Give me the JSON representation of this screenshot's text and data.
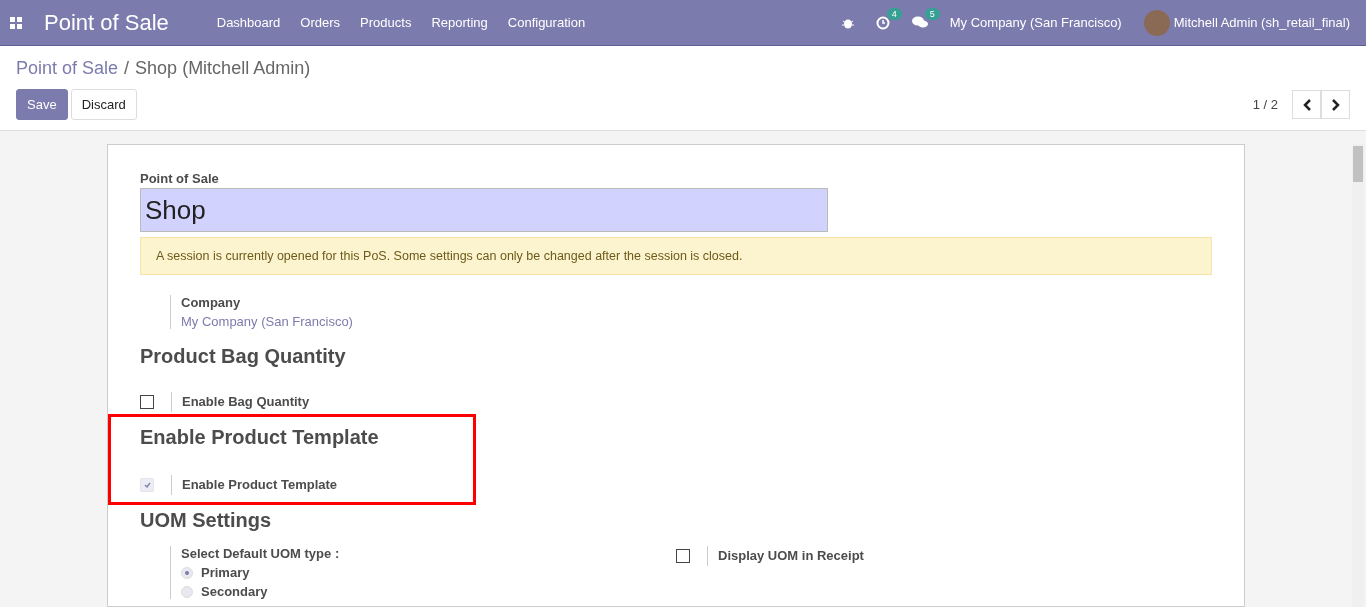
{
  "navbar": {
    "app_title": "Point of Sale",
    "menu": [
      "Dashboard",
      "Orders",
      "Products",
      "Reporting",
      "Configuration"
    ],
    "activity_count": "4",
    "message_count": "5",
    "company": "My Company (San Francisco)",
    "user": "Mitchell Admin (sh_retail_final)"
  },
  "breadcrumb": {
    "parent": "Point of Sale",
    "separator": "/",
    "current": "Shop (Mitchell Admin)"
  },
  "buttons": [
    {
      "label": "Save",
      "kind": "primary"
    },
    {
      "label": "Discard",
      "kind": "secondary"
    }
  ],
  "pager": {
    "value": "1 / 2"
  },
  "form": {
    "name_label": "Point of Sale",
    "name_value": "Shop",
    "alert": "A session is currently opened for this PoS. Some settings can only be changed after the session is closed.",
    "company_label": "Company",
    "company_value": "My Company (San Francisco)",
    "sections": [
      {
        "title": "Product Bag Quantity",
        "highlighted": false,
        "settings": [
          {
            "label": "Enable Bag Quantity",
            "checked": false,
            "disabled": false
          }
        ]
      },
      {
        "title": "Enable Product Template",
        "highlighted": true,
        "settings": [
          {
            "label": "Enable Product Template",
            "checked": true,
            "disabled": true
          }
        ]
      }
    ],
    "uom": {
      "title": "UOM Settings",
      "type_label": "Select Default UOM type",
      "separator": ":",
      "options": [
        {
          "label": "Primary",
          "selected": true
        },
        {
          "label": "Secondary",
          "selected": false
        }
      ],
      "receipt_label": "Display UOM in Receipt",
      "receipt_checked": false
    }
  }
}
